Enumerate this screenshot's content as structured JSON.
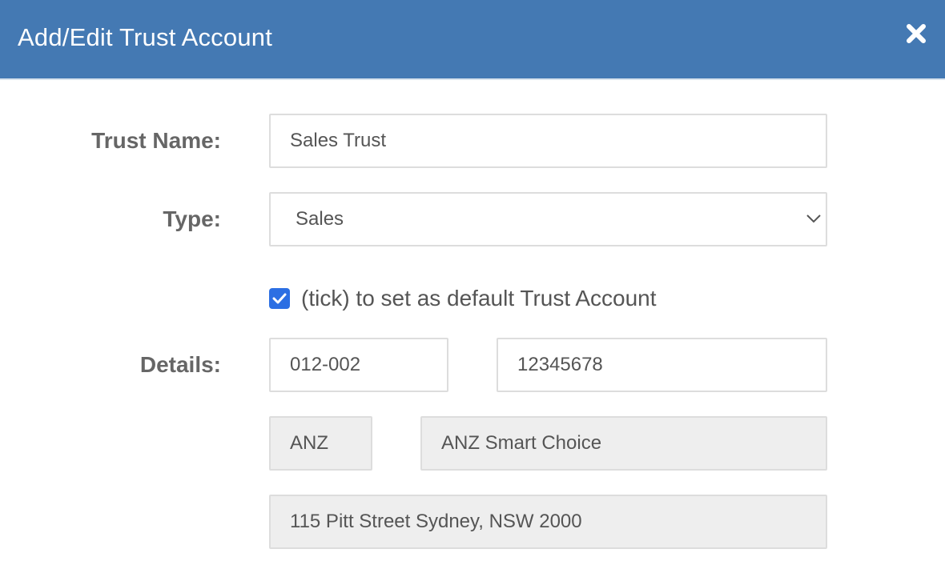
{
  "dialog": {
    "title": "Add/Edit Trust Account",
    "close_icon": "close-icon"
  },
  "form": {
    "trust_name": {
      "label": "Trust Name:",
      "value": "Sales Trust"
    },
    "type": {
      "label": "Type:",
      "selected": "Sales"
    },
    "default_checkbox": {
      "checked": true,
      "label": "(tick) to set as default Trust Account"
    },
    "details": {
      "label": "Details:",
      "bsb": "012-002",
      "account_number": "12345678",
      "bank_code": "ANZ",
      "account_name": "ANZ Smart Choice",
      "address": "115 Pitt Street Sydney, NSW 2000"
    }
  },
  "colors": {
    "header": "#4479b3",
    "checkbox": "#2c6fe3"
  }
}
